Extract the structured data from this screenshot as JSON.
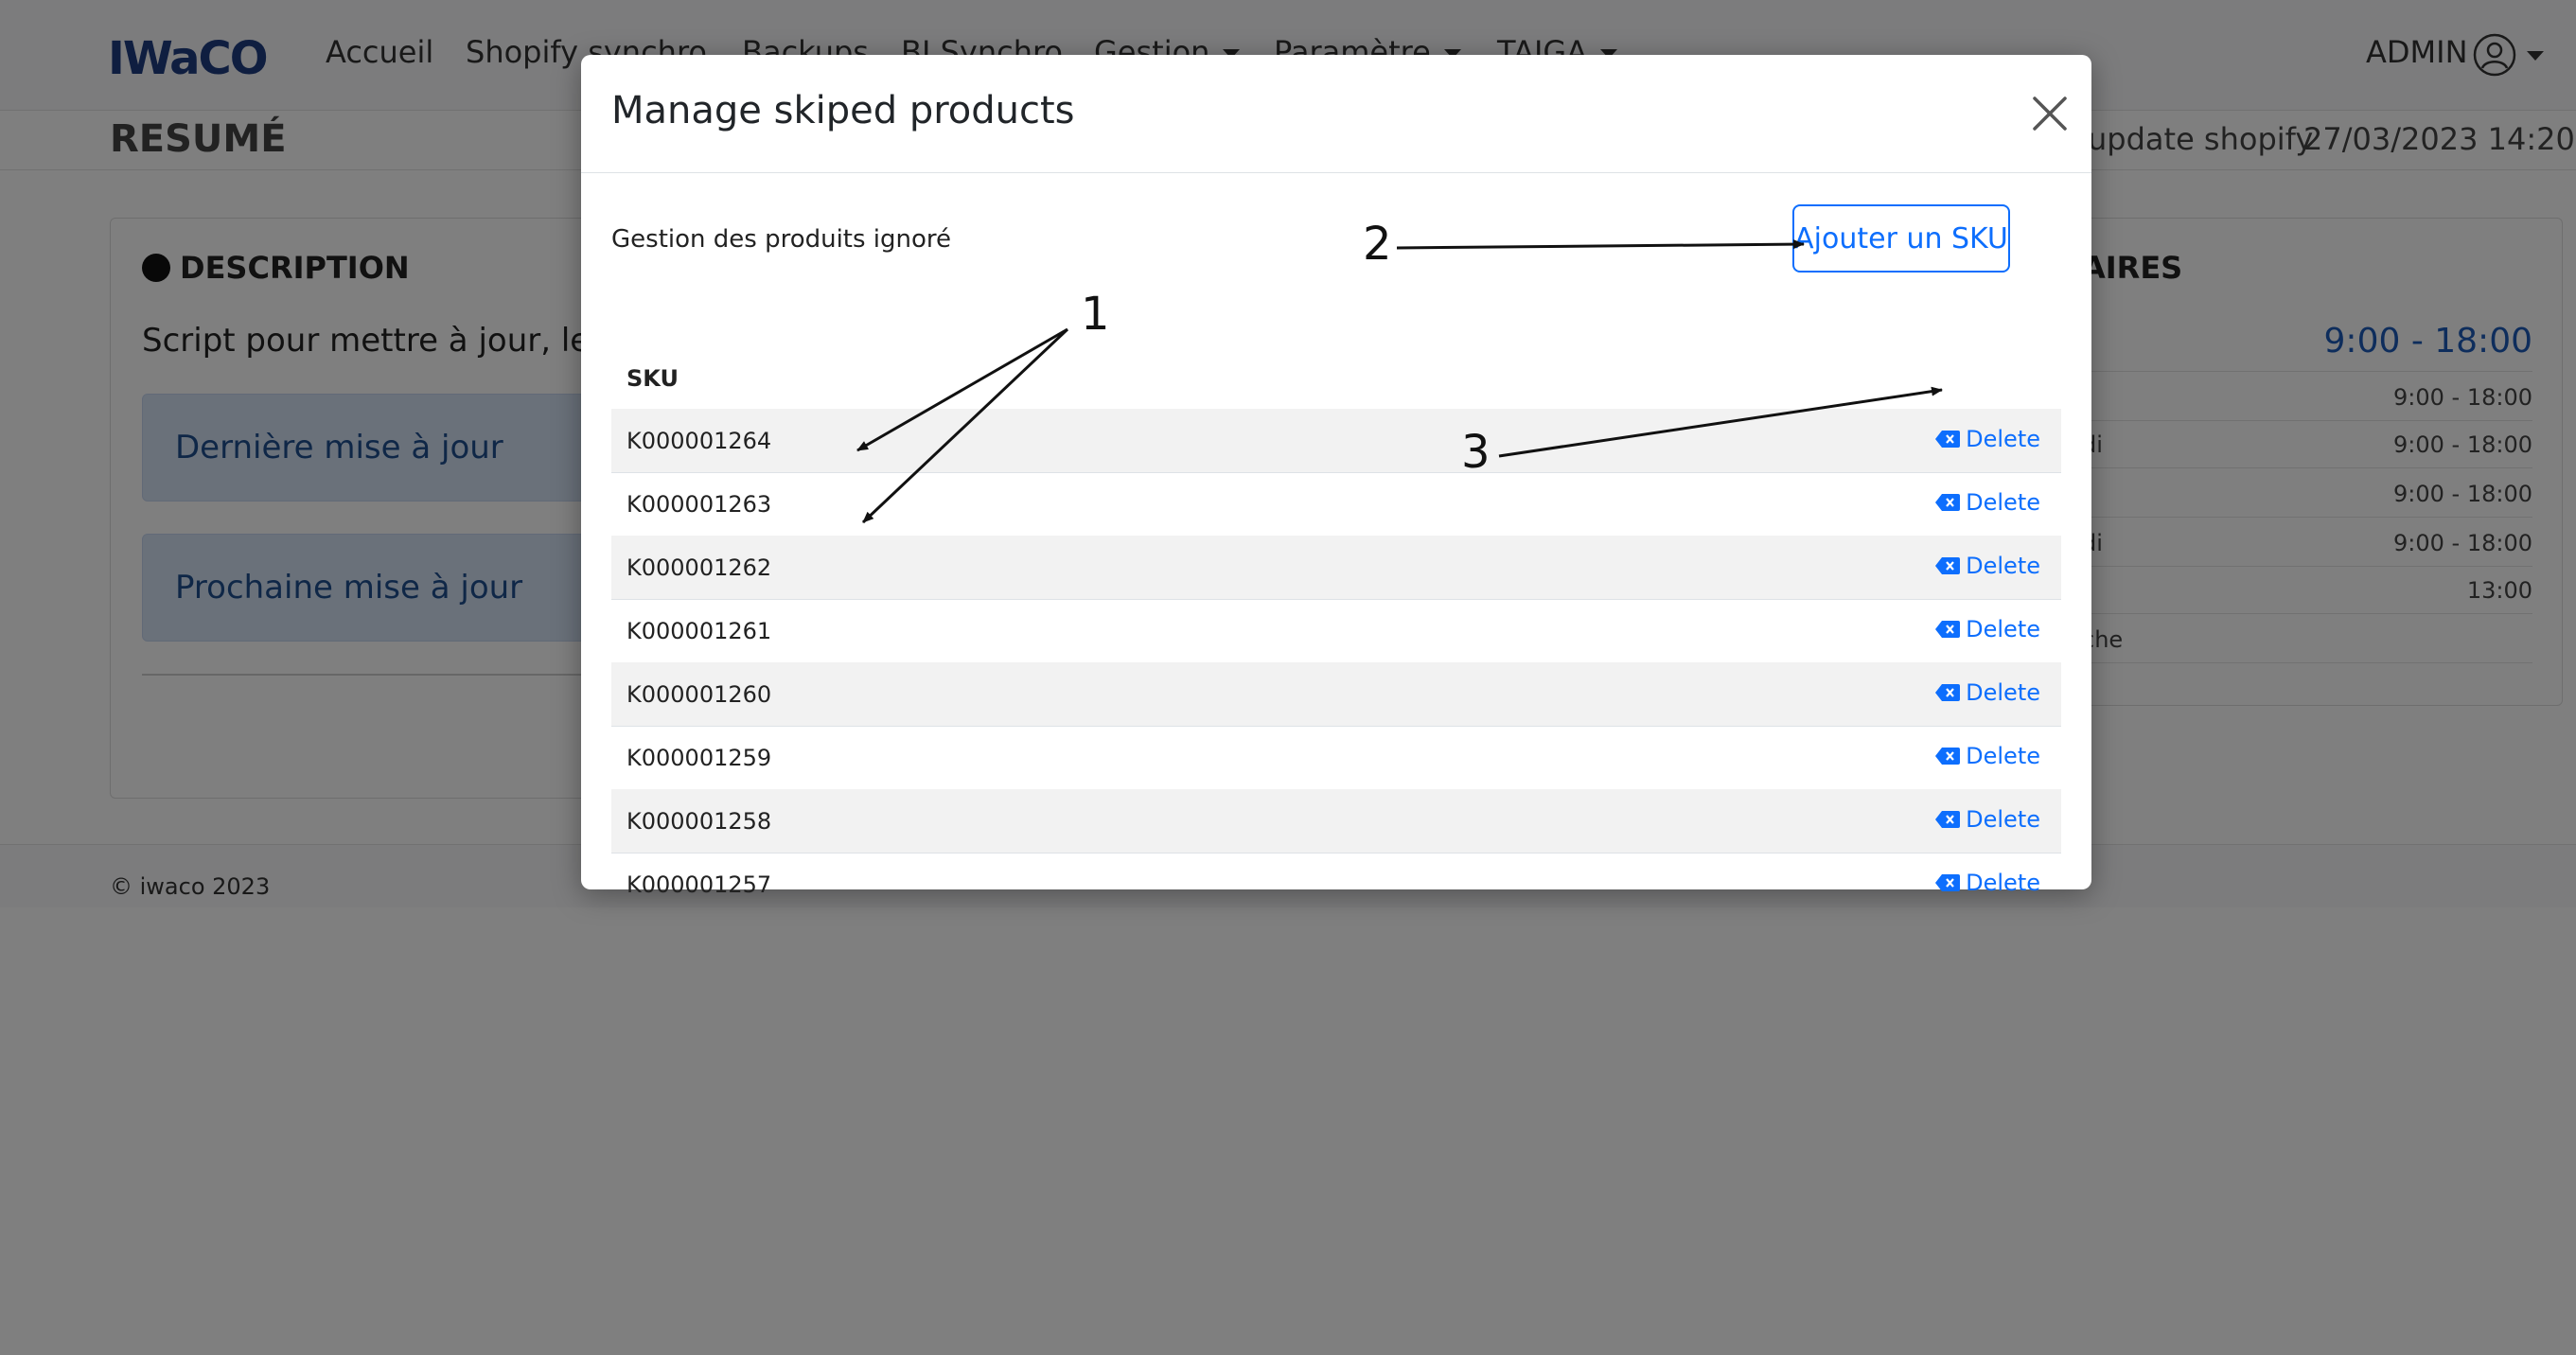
{
  "navbar": {
    "logo": "IWaCO",
    "items": [
      {
        "label": "Accueil"
      },
      {
        "label": "Shopify synchro"
      },
      {
        "label": "Backups"
      },
      {
        "label": "BI Synchro"
      },
      {
        "label": "Gestion"
      },
      {
        "label": "Paramètre"
      },
      {
        "label": "TAIGA"
      }
    ],
    "user_label": "ADMIN"
  },
  "subheader": {
    "title": "RESUMÉ",
    "last_update_label": "update shopify",
    "last_update_value": "27/03/2023 14:20"
  },
  "description_card": {
    "title": "DESCRIPTION",
    "text": "Script pour mettre à jour, le p",
    "last_update_label": "Dernière mise à jour",
    "next_update_label": "Prochaine mise à jour"
  },
  "hours_card": {
    "title": "AIRES",
    "main": {
      "day": "i",
      "time": "9:00 - 18:00"
    },
    "rows": [
      {
        "day": "",
        "time": "9:00 - 18:00"
      },
      {
        "day": "di",
        "time": "9:00 - 18:00"
      },
      {
        "day": "",
        "time": "9:00 - 18:00"
      },
      {
        "day": "di",
        "time": "9:00 - 18:00"
      },
      {
        "day": "i",
        "time": "13:00"
      },
      {
        "day": "che",
        "time": ""
      }
    ]
  },
  "footer": {
    "text": "© iwaco 2023"
  },
  "modal": {
    "title": "Manage skiped products",
    "section_label": "Gestion des produits ignoré",
    "add_button_label": "Ajouter un SKU",
    "table": {
      "header": "SKU",
      "delete_label": "Delete",
      "rows": [
        "K000001264",
        "K000001263",
        "K000001262",
        "K000001261",
        "K000001260",
        "K000001259",
        "K000001258",
        "K000001257"
      ]
    }
  },
  "annotations": [
    "1",
    "2",
    "3"
  ]
}
